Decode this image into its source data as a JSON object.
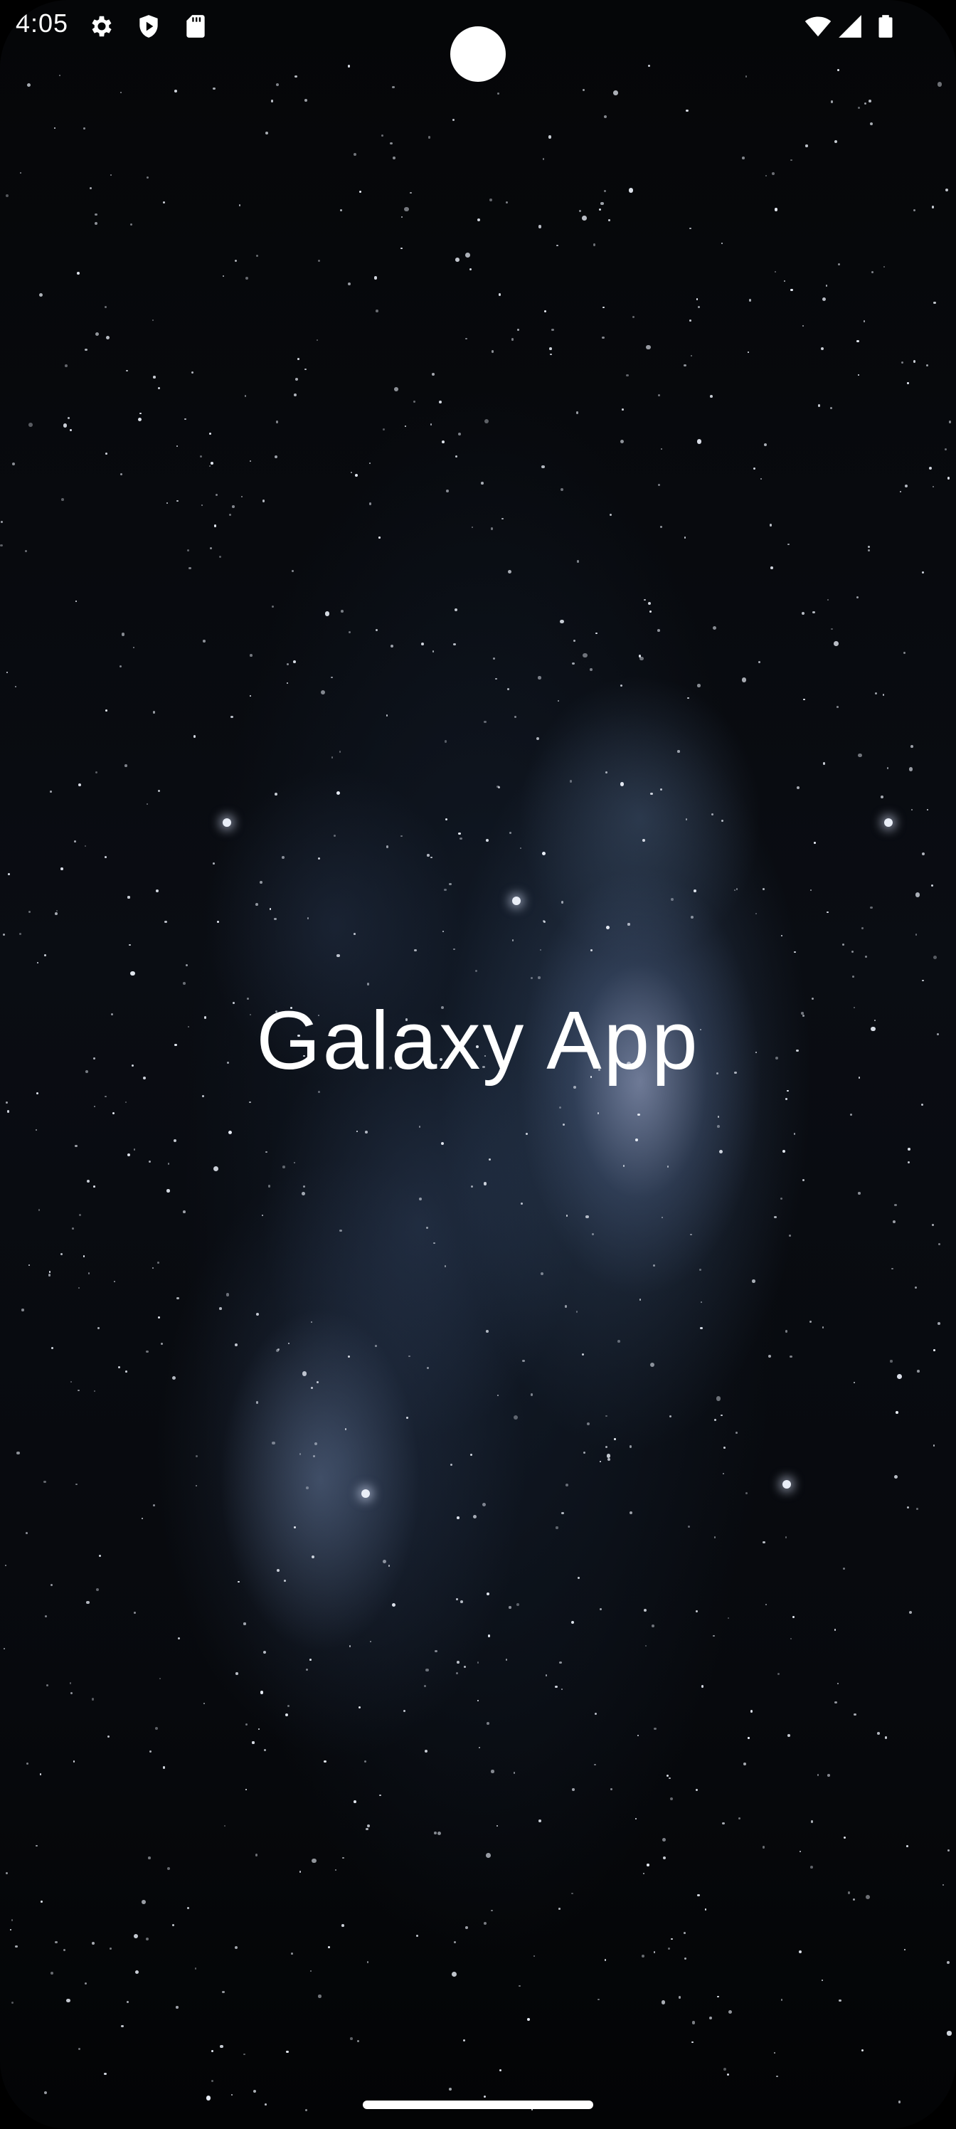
{
  "status_bar": {
    "time": "4:05",
    "left_icons": [
      "settings-icon",
      "shield-icon",
      "sd-card-icon"
    ],
    "right_icons": [
      "wifi-icon",
      "cellular-signal-icon",
      "battery-icon"
    ]
  },
  "main": {
    "title": "Galaxy App"
  },
  "colors": {
    "background": "#000000",
    "text": "#ffffff"
  }
}
